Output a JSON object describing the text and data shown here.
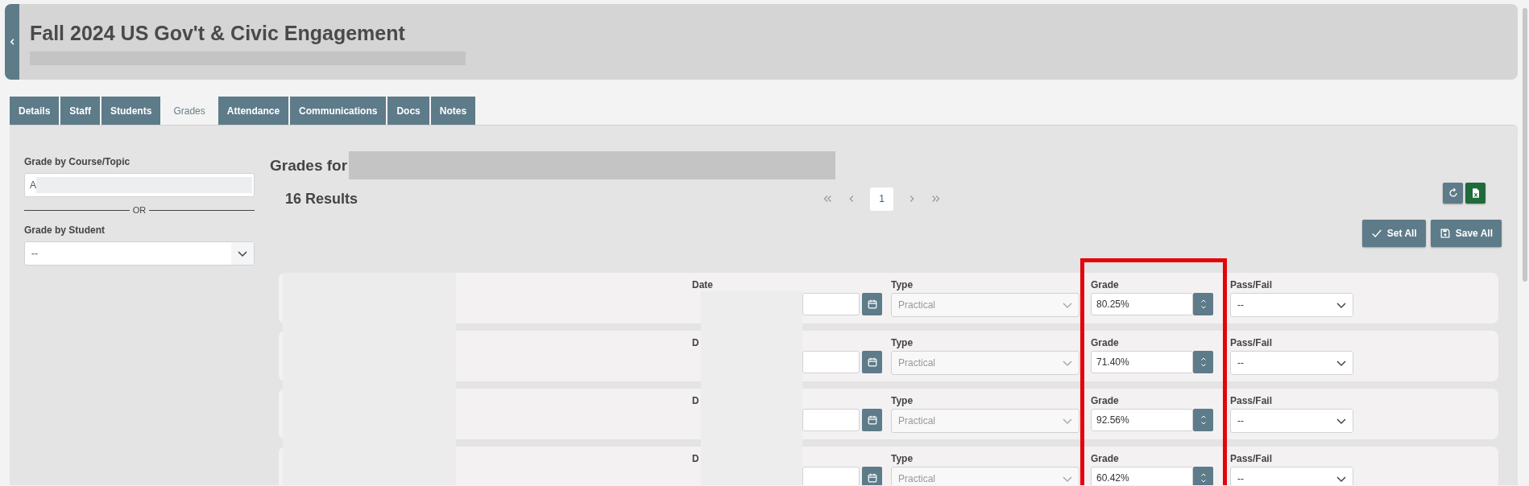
{
  "header": {
    "title": "Fall 2024 US Gov't & Civic Engagement"
  },
  "tabs": [
    {
      "label": "Details",
      "selected": false
    },
    {
      "label": "Staff",
      "selected": false
    },
    {
      "label": "Students",
      "selected": false
    },
    {
      "label": "Grades",
      "selected": true
    },
    {
      "label": "Attendance",
      "selected": false
    },
    {
      "label": "Communications",
      "selected": false
    },
    {
      "label": "Docs",
      "selected": false
    },
    {
      "label": "Notes",
      "selected": false
    }
  ],
  "filters": {
    "course_label": "Grade by Course/Topic",
    "course_value": "A",
    "divider": "OR",
    "student_label": "Grade by Student",
    "student_value": "--"
  },
  "results": {
    "heading": "Grades for",
    "count": "16 Results",
    "pages": [
      {
        "label": "1",
        "selected": true
      }
    ],
    "buttons": [
      {
        "kind": "check",
        "label": "Set All"
      },
      {
        "kind": "save",
        "label": "Save All"
      }
    ]
  },
  "grade_highlighted": true,
  "rows": [
    {
      "date_label": "Date",
      "type_label": "Type",
      "type_value": "Practical",
      "type_disabled": true,
      "grade_label": "Grade",
      "grade_value": "80.25%",
      "passfail_label": "Pass/Fail",
      "passfail_value": "--"
    },
    {
      "date_label": "D",
      "type_label": "Type",
      "type_value": "Practical",
      "type_disabled": true,
      "grade_label": "Grade",
      "grade_value": "71.40%",
      "passfail_label": "Pass/Fail",
      "passfail_value": "--"
    },
    {
      "date_label": "D",
      "type_label": "Type",
      "type_value": "Practical",
      "type_disabled": true,
      "grade_label": "Grade",
      "grade_value": "92.56%",
      "passfail_label": "Pass/Fail",
      "passfail_value": "--"
    },
    {
      "date_label": "D",
      "type_label": "Type",
      "type_value": "Practical",
      "type_disabled": true,
      "grade_label": "Grade",
      "grade_value": "60.42%",
      "passfail_label": "Pass/Fail",
      "passfail_value": "--"
    }
  ]
}
